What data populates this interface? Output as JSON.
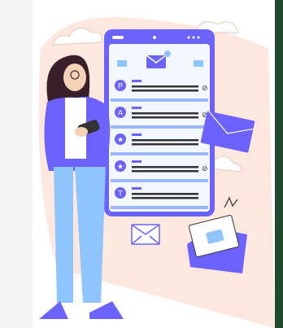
{
  "illustration": {
    "scene": "woman-using-phone-with-email-inbox",
    "accent_color": "#6c63ff",
    "secondary_color": "#9ab7ff",
    "background_blob_color": "#fde7de",
    "dark_strip_color": "#1f4a2b"
  },
  "inbox": {
    "rows": [
      {
        "avatar_letter": "P",
        "has_attachment": true
      },
      {
        "avatar_letter": "A",
        "has_attachment": true
      },
      {
        "avatar_letter": "★",
        "has_attachment": false
      },
      {
        "avatar_letter": "★",
        "has_attachment": true
      },
      {
        "avatar_letter": "T",
        "has_attachment": false
      }
    ]
  }
}
